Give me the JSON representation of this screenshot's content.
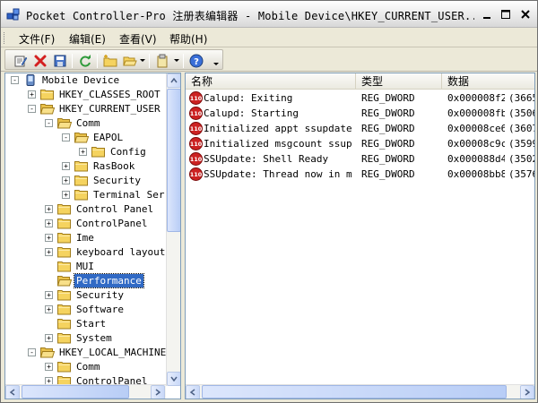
{
  "window": {
    "title": "Pocket Controller-Pro 注册表编辑器 - Mobile Device\\HKEY_CURRENT_USER...",
    "app_icon": "registry-editor-icon"
  },
  "menubar": {
    "items": [
      {
        "label": "文件(F)"
      },
      {
        "label": "编辑(E)"
      },
      {
        "label": "查看(V)"
      },
      {
        "label": "帮助(H)"
      }
    ]
  },
  "toolbar": {
    "buttons": [
      {
        "icon": "edit-value-icon"
      },
      {
        "icon": "delete-icon"
      },
      {
        "icon": "save-icon"
      },
      {
        "icon": "refresh-icon"
      },
      {
        "icon": "new-folder-icon"
      },
      {
        "icon": "open-folder-icon"
      },
      {
        "icon": "clipboard-icon"
      },
      {
        "icon": "help-icon"
      }
    ]
  },
  "tree": {
    "items": [
      {
        "label": "Mobile Device",
        "depth": 0,
        "expander": "-",
        "kind": "device"
      },
      {
        "label": "HKEY_CLASSES_ROOT",
        "depth": 1,
        "expander": "+",
        "kind": "folder"
      },
      {
        "label": "HKEY_CURRENT_USER",
        "depth": 1,
        "expander": "-",
        "kind": "folder-open"
      },
      {
        "label": "Comm",
        "depth": 2,
        "expander": "-",
        "kind": "folder-open"
      },
      {
        "label": "EAPOL",
        "depth": 3,
        "expander": "-",
        "kind": "folder-open"
      },
      {
        "label": "Config",
        "depth": 4,
        "expander": "+",
        "kind": "folder"
      },
      {
        "label": "RasBook",
        "depth": 3,
        "expander": "+",
        "kind": "folder"
      },
      {
        "label": "Security",
        "depth": 3,
        "expander": "+",
        "kind": "folder"
      },
      {
        "label": "Terminal Ser",
        "depth": 3,
        "expander": "+",
        "kind": "folder"
      },
      {
        "label": "Control Panel",
        "depth": 2,
        "expander": "+",
        "kind": "folder"
      },
      {
        "label": "ControlPanel",
        "depth": 2,
        "expander": "+",
        "kind": "folder"
      },
      {
        "label": "Ime",
        "depth": 2,
        "expander": "+",
        "kind": "folder"
      },
      {
        "label": "keyboard layout",
        "depth": 2,
        "expander": "+",
        "kind": "folder"
      },
      {
        "label": "MUI",
        "depth": 2,
        "expander": "",
        "kind": "folder"
      },
      {
        "label": "Performance",
        "depth": 2,
        "expander": "",
        "kind": "folder-open",
        "selected": true
      },
      {
        "label": "Security",
        "depth": 2,
        "expander": "+",
        "kind": "folder"
      },
      {
        "label": "Software",
        "depth": 2,
        "expander": "+",
        "kind": "folder"
      },
      {
        "label": "Start",
        "depth": 2,
        "expander": "",
        "kind": "folder"
      },
      {
        "label": "System",
        "depth": 2,
        "expander": "+",
        "kind": "folder"
      },
      {
        "label": "HKEY_LOCAL_MACHINE",
        "depth": 1,
        "expander": "-",
        "kind": "folder-open"
      },
      {
        "label": "Comm",
        "depth": 2,
        "expander": "+",
        "kind": "folder"
      },
      {
        "label": "ControlPanel",
        "depth": 2,
        "expander": "+",
        "kind": "folder"
      }
    ]
  },
  "list": {
    "columns": [
      {
        "label": "名称"
      },
      {
        "label": "类型"
      },
      {
        "label": "数据"
      }
    ],
    "rows": [
      {
        "name": "Calupd: Exiting",
        "type": "REG_DWORD",
        "data": "0x000008f2c",
        "extra": "(3665"
      },
      {
        "name": "Calupd: Starting",
        "type": "REG_DWORD",
        "data": "0x000008fb",
        "extra": "(3506"
      },
      {
        "name": "Initialized appt ssupdate",
        "type": "REG_DWORD",
        "data": "0x00008ce6",
        "extra": "(3607"
      },
      {
        "name": "Initialized msgcount ssup...",
        "type": "REG_DWORD",
        "data": "0x00008c9c",
        "extra": "(3599"
      },
      {
        "name": "SSUpdate: Shell Ready",
        "type": "REG_DWORD",
        "data": "0x000088d4",
        "extra": "(3502"
      },
      {
        "name": "SSUpdate: Thread now in m...",
        "type": "REG_DWORD",
        "data": "0x00008bb8",
        "extra": "(3576"
      }
    ],
    "row_icon": "dword-value-icon",
    "row_icon_text": "110"
  },
  "colors": {
    "selection": "#316ac5",
    "folder": "#f5d35f",
    "value_icon": "#cc2222"
  }
}
